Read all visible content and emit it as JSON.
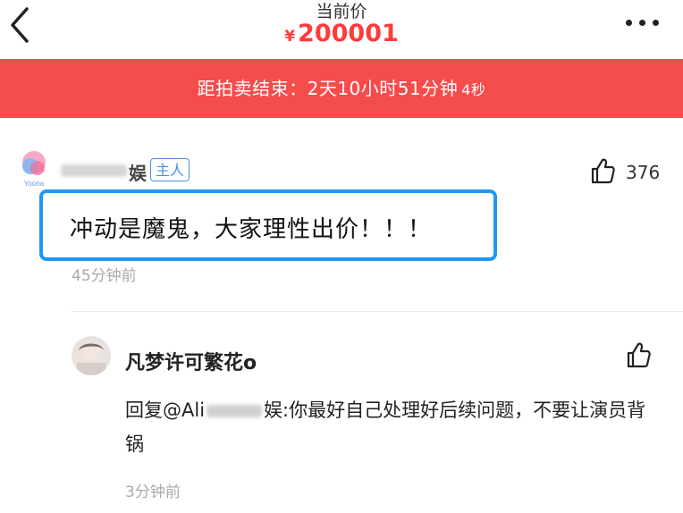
{
  "header": {
    "title_label": "当前价",
    "price_currency": "¥",
    "price_value": "200001"
  },
  "countdown": {
    "prefix": "距拍卖结束：",
    "remaining": "2天10小时51分钟",
    "seconds": "4秒"
  },
  "comment": {
    "author_visible_suffix": "娱",
    "badge": "主人",
    "like_count": "376",
    "text": "冲动是魔鬼，大家理性出价！！！",
    "time": "45分钟前",
    "avatar_caption": "Yoona"
  },
  "reply": {
    "author": "凡梦许可繁花o",
    "text_prefix": "回复@Ali",
    "text_suffix": "娱:你最好自己处理好后续问题，不要让演员背锅",
    "time": "3分钟前"
  },
  "colors": {
    "price_red": "#ff3b3b",
    "banner_red": "#f54c4c",
    "badge_blue": "#4a90e2",
    "highlight_blue": "#2196f3"
  },
  "icons": {
    "back": "chevron-left-icon",
    "more": "more-dots-icon",
    "like": "thumbs-up-icon"
  }
}
